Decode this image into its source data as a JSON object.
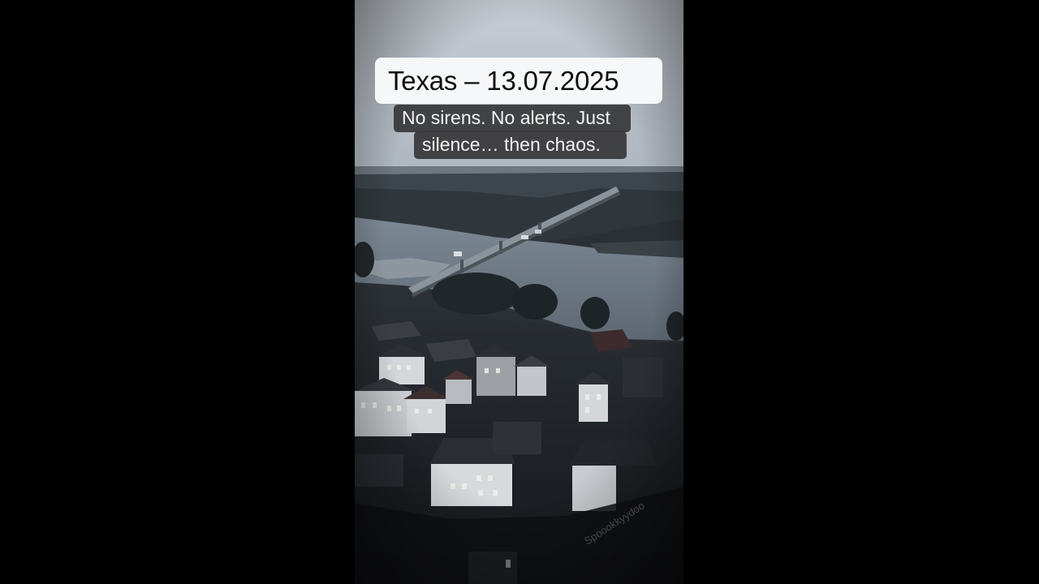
{
  "video": {
    "title": "Texas – 13.07.2025",
    "caption_lines": [
      "No sirens. No alerts. Just",
      "silence… then chaos."
    ],
    "watermark": "Spoookkyydoo"
  },
  "colors": {
    "letterbox": "#000000",
    "sky": "#c9cfd6",
    "river": "#8d99a5",
    "title_background": "#f6f7f8",
    "caption_background": "#343436"
  }
}
